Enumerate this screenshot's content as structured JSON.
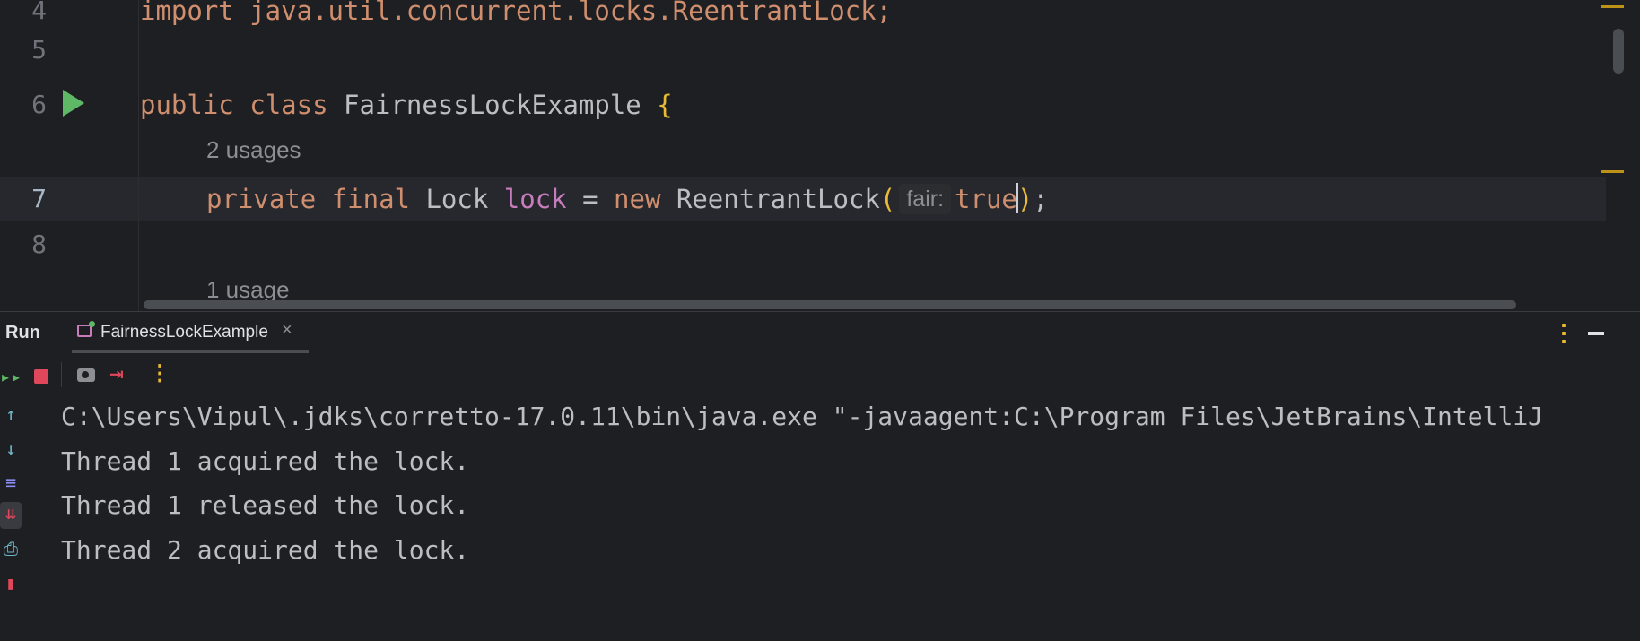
{
  "editor": {
    "line_numbers": [
      "4",
      "5",
      "6",
      "7",
      "8"
    ],
    "lines": {
      "l4": "import java.util.concurrent.locks.ReentrantLock;",
      "l6_kw1": "public",
      "l6_kw2": "class",
      "l6_name": "FairnessLockExample",
      "l6_brace": "{",
      "usages_1": "2 usages",
      "l7_kw1": "private",
      "l7_kw2": "final",
      "l7_type": "Lock",
      "l7_field": "lock",
      "l7_eq": "=",
      "l7_new": "new",
      "l7_ctor": "ReentrantLock",
      "l7_open": "(",
      "l7_hint": "fair:",
      "l7_arg": "true",
      "l7_close": ")",
      "l7_semi": ";",
      "usages_2": "1 usage"
    }
  },
  "run_panel": {
    "title": "Run",
    "tab_label": "FairnessLockExample",
    "tab_close": "×",
    "more": "⋮",
    "toolbar": {
      "more": "⋮"
    },
    "console_lines": [
      "C:\\Users\\Vipul\\.jdks\\corretto-17.0.11\\bin\\java.exe \"-javaagent:C:\\Program Files\\JetBrains\\IntelliJ",
      "Thread 1 acquired the lock.",
      "Thread 1 released the lock.",
      "Thread 2 acquired the lock."
    ]
  },
  "colors": {
    "background": "#1e1f22",
    "keyword": "#cf8e6d",
    "field": "#c77dbb",
    "brace": "#e8ba36",
    "run_icon": "#5fb865",
    "stop": "#e0475b"
  }
}
